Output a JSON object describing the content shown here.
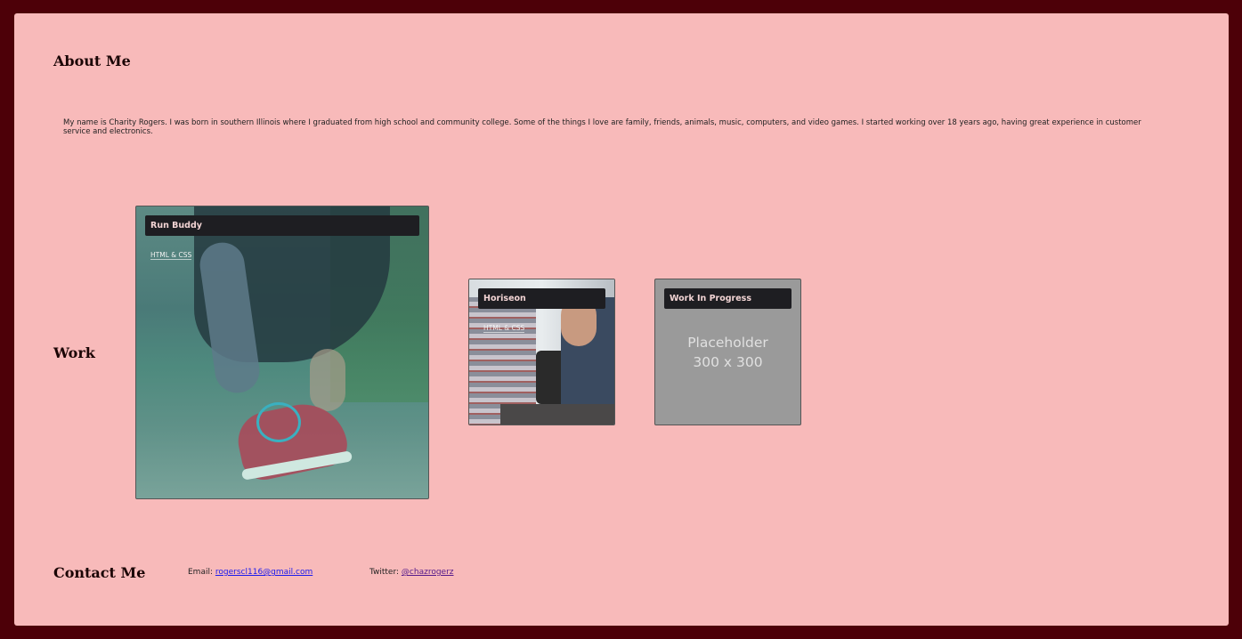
{
  "about": {
    "heading": "About Me",
    "text": "My name is Charity Rogers. I was born in southern Illinois where I graduated from high school and community college. Some of the things I love are family, friends, animals, music, computers, and video games. I started working over 18 years ago, having great experience in customer service and electronics."
  },
  "work": {
    "heading": "Work",
    "projects": [
      {
        "title": "Run Buddy",
        "tag": "HTML & CSS"
      },
      {
        "title": "Horiseon",
        "tag": "HTML & CSS"
      },
      {
        "title": "Work In Progress",
        "placeholder_line1": "Placeholder",
        "placeholder_line2": "300 x 300"
      }
    ]
  },
  "contact": {
    "heading": "Contact Me",
    "email_label": "Email:",
    "email": "rogerscl116@gmail.com",
    "twitter_label": "Twitter:",
    "twitter": "@chazrogerz"
  },
  "colors": {
    "background": "#4d0008",
    "panel": "#f8baba",
    "title_bar": "#1e1e22"
  }
}
